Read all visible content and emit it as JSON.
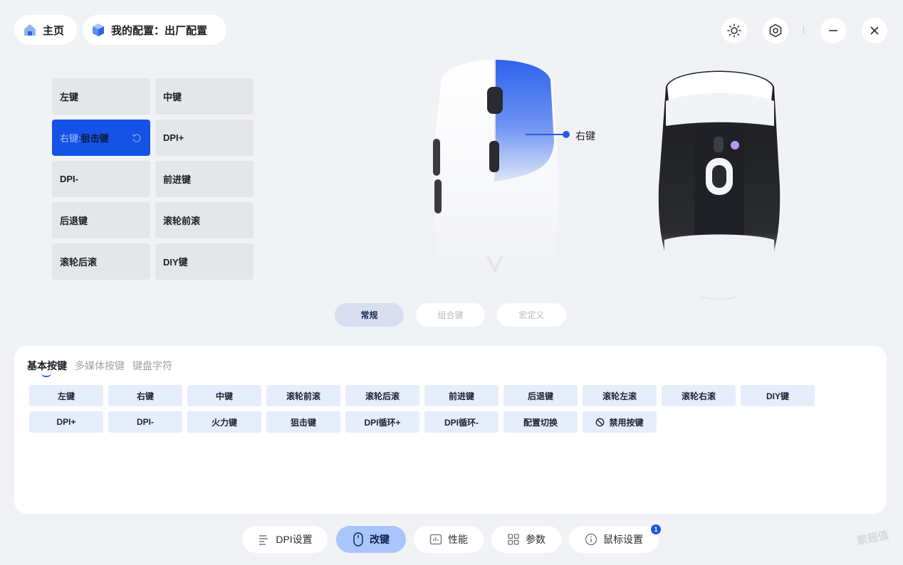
{
  "header": {
    "home_label": "主页",
    "profile_label": "我的配置：出厂配置",
    "icons": [
      "sun-icon",
      "hex-settings-icon",
      "minimize-icon",
      "close-icon"
    ]
  },
  "key_list": [
    {
      "label": "左键"
    },
    {
      "label": "中键"
    },
    {
      "prefix": "右键:",
      "label": "狙击键",
      "active": true
    },
    {
      "label": "DPI+"
    },
    {
      "label": "DPI-"
    },
    {
      "label": "前进键"
    },
    {
      "label": "后退键"
    },
    {
      "label": "滚轮前滚"
    },
    {
      "label": "滚轮后滚"
    },
    {
      "label": "DIY键"
    }
  ],
  "mouse_callout": "右键",
  "mode_tabs": [
    {
      "label": "常规",
      "active": true
    },
    {
      "label": "组合键",
      "active": false
    },
    {
      "label": "宏定义",
      "active": false
    }
  ],
  "panel": {
    "tabs": [
      {
        "label": "基本按键",
        "active": true
      },
      {
        "label": "多媒体按键",
        "active": false
      },
      {
        "label": "键盘字符",
        "active": false
      }
    ],
    "row1": [
      "左键",
      "右键",
      "中键",
      "滚轮前滚",
      "滚轮后滚",
      "前进键",
      "后退键",
      "滚轮左滚",
      "滚轮右滚",
      "DIY键"
    ],
    "row2": [
      "DPI+",
      "DPI-",
      "火力键",
      "狙击键",
      "DPI循环+",
      "DPI循环-",
      "配置切换",
      "禁用按键"
    ]
  },
  "bottom_nav": [
    {
      "label": "DPI设置",
      "icon": "dpi-bars-icon",
      "active": false
    },
    {
      "label": "改键",
      "icon": "mouse-icon",
      "active": true
    },
    {
      "label": "性能",
      "icon": "performance-icon",
      "active": false
    },
    {
      "label": "参数",
      "icon": "grid-icon",
      "active": false
    },
    {
      "label": "鼠标设置",
      "icon": "info-icon",
      "active": false,
      "badge": "1"
    }
  ],
  "colors": {
    "accent": "#1453e6",
    "nav_active": "#a9c5fb",
    "option_bg": "#e6eefb"
  }
}
